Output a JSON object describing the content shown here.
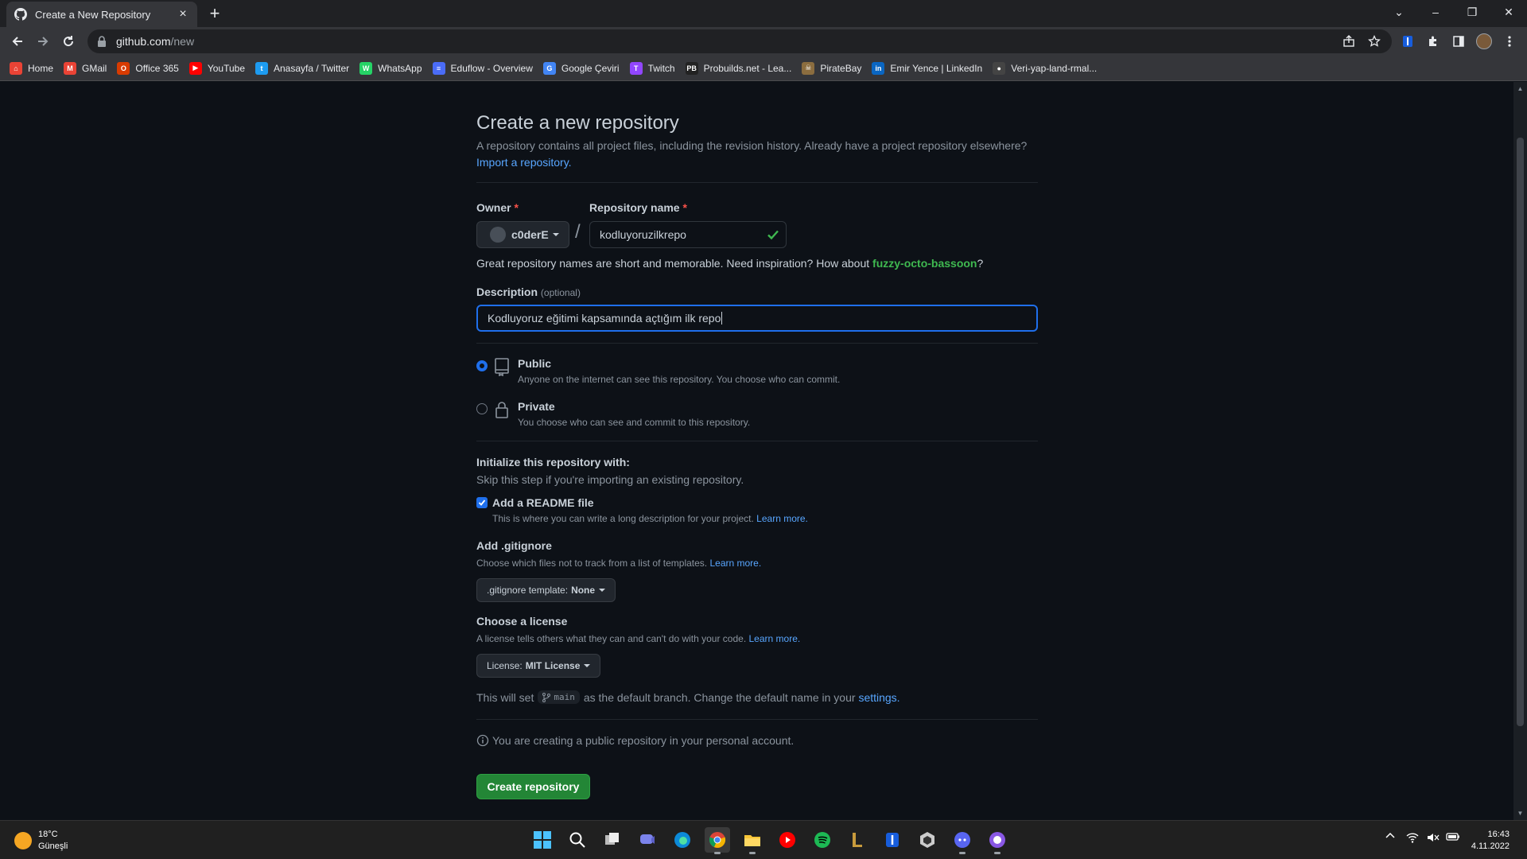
{
  "browser": {
    "tab_title": "Create a New Repository",
    "url_host": "github.com",
    "url_path": "/new",
    "bookmarks": [
      {
        "label": "Home",
        "color": "#ea4335",
        "glyph": "⌂"
      },
      {
        "label": "GMail",
        "color": "#ea4335",
        "glyph": "M"
      },
      {
        "label": "Office 365",
        "color": "#d83b01",
        "glyph": "O"
      },
      {
        "label": "YouTube",
        "color": "#ff0000",
        "glyph": "▶"
      },
      {
        "label": "Anasayfa / Twitter",
        "color": "#1d9bf0",
        "glyph": "t"
      },
      {
        "label": "WhatsApp",
        "color": "#25d366",
        "glyph": "W"
      },
      {
        "label": "Eduflow - Overview",
        "color": "#4a6cf7",
        "glyph": "≡"
      },
      {
        "label": "Google Çeviri",
        "color": "#4285f4",
        "glyph": "G"
      },
      {
        "label": "Twitch",
        "color": "#9146ff",
        "glyph": "T"
      },
      {
        "label": "Probuilds.net - Lea...",
        "color": "#222222",
        "glyph": "PB"
      },
      {
        "label": "PirateBay",
        "color": "#8b6d3f",
        "glyph": "☠"
      },
      {
        "label": "Emir Yence | LinkedIn",
        "color": "#0a66c2",
        "glyph": "in"
      },
      {
        "label": "Veri-yap-land-rmal...",
        "color": "#444444",
        "glyph": "●"
      }
    ]
  },
  "page": {
    "title": "Create a new repository",
    "subtitle": "A repository contains all project files, including the revision history. Already have a project repository elsewhere?",
    "import_link": "Import a repository.",
    "owner_label": "Owner",
    "owner_value": "c0derE",
    "repo_name_label": "Repository name",
    "repo_name_value": "kodluyoruzilkrepo",
    "required_mark": "*",
    "slash": "/",
    "hint_prefix": "Great repository names are short and memorable. Need inspiration? How about",
    "hint_suggestion": "fuzzy-octo-bassoon",
    "hint_suffix": "?",
    "description_label": "Description",
    "description_optional": "(optional)",
    "description_value": "Kodluyoruz eğitimi kapsamında açtığım ilk repo",
    "public_title": "Public",
    "public_desc": "Anyone on the internet can see this repository. You choose who can commit.",
    "private_title": "Private",
    "private_desc": "You choose who can see and commit to this repository.",
    "init_title": "Initialize this repository with:",
    "init_desc": "Skip this step if you're importing an existing repository.",
    "readme_label": "Add a README file",
    "readme_desc": "This is where you can write a long description for your project.",
    "learn_more": "Learn more.",
    "gitignore_title": "Add .gitignore",
    "gitignore_desc": "Choose which files not to track from a list of templates.",
    "gitignore_btn_label": ".gitignore template:",
    "gitignore_btn_value": "None",
    "license_title": "Choose a license",
    "license_desc": "A license tells others what they can and can't do with your code.",
    "license_btn_label": "License:",
    "license_btn_value": "MIT License",
    "branch_prefix": "This will set",
    "branch_name": "main",
    "branch_suffix": "as the default branch. Change the default name in your",
    "settings_link": "settings.",
    "info_text": "You are creating a public repository in your personal account.",
    "create_button": "Create repository"
  },
  "taskbar": {
    "temperature": "18°C",
    "weather": "Güneşli",
    "time": "16:43",
    "date": "4.11.2022"
  },
  "colors": {
    "accent_blue": "#1f6feb",
    "link_blue": "#58a6ff",
    "success_green": "#238636",
    "suggestion_green": "#3fb950",
    "required_red": "#f85149"
  }
}
